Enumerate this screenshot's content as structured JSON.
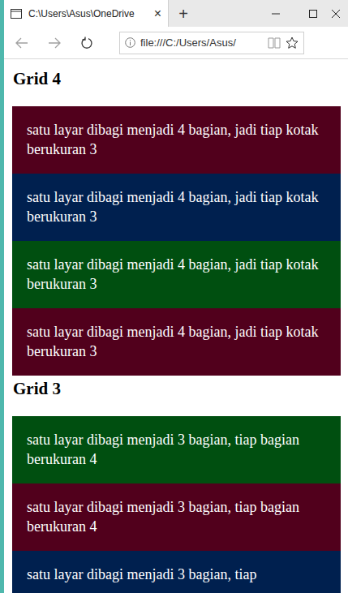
{
  "window": {
    "title": "C:\\Users\\Asus\\OneDrive",
    "tab_close": "×",
    "new_tab": "+"
  },
  "address_bar": {
    "url": "file:///C:/Users/Asus/"
  },
  "sections": [
    {
      "heading": "Grid 4",
      "boxes": [
        {
          "text": "satu layar dibagi menjadi 4 bagian, jadi tiap kotak berukuran 3",
          "color": "#51001c"
        },
        {
          "text": "satu layar dibagi menjadi 4 bagian, jadi tiap kotak berukuran 3",
          "color": "#00204f"
        },
        {
          "text": "satu layar dibagi menjadi 4 bagian, jadi tiap kotak berukuran 3",
          "color": "#004f10"
        },
        {
          "text": "satu layar dibagi menjadi 4 bagian, jadi tiap kotak berukuran 3",
          "color": "#51001c"
        }
      ]
    },
    {
      "heading": "Grid 3",
      "boxes": [
        {
          "text": "satu layar dibagi menjadi 3 bagian, tiap bagian berukuran 4",
          "color": "#004f10"
        },
        {
          "text": "satu layar dibagi menjadi 3 bagian, tiap bagian berukuran 4",
          "color": "#51001c"
        },
        {
          "text": "satu layar dibagi menjadi 3 bagian, tiap",
          "color": "#00204f"
        }
      ]
    }
  ]
}
